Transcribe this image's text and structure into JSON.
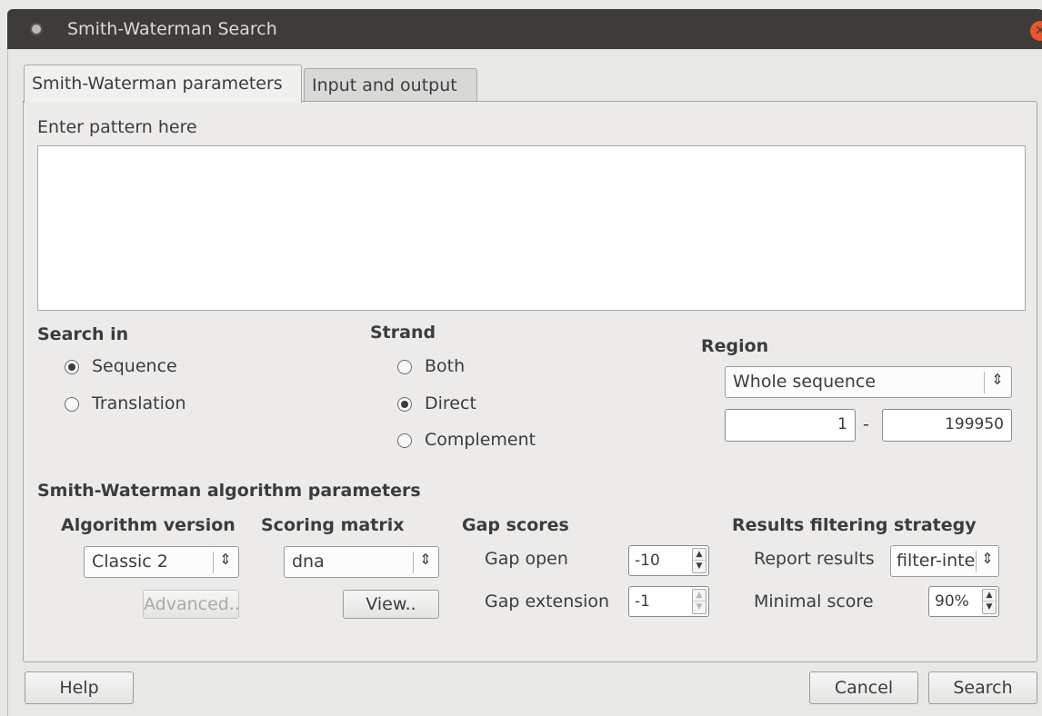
{
  "window": {
    "title": "Smith-Waterman Search"
  },
  "tabs": [
    {
      "label": "Smith-Waterman parameters"
    },
    {
      "label": "Input and output"
    }
  ],
  "pattern": {
    "label": "Enter pattern here",
    "value": ""
  },
  "search_in": {
    "heading": "Search in",
    "options": [
      {
        "label": "Sequence",
        "checked": true
      },
      {
        "label": "Translation",
        "checked": false
      }
    ]
  },
  "strand": {
    "heading": "Strand",
    "options": [
      {
        "label": "Both",
        "checked": false
      },
      {
        "label": "Direct",
        "checked": true
      },
      {
        "label": "Complement",
        "checked": false
      }
    ]
  },
  "region": {
    "heading": "Region",
    "selected": "Whole sequence",
    "start": "1",
    "separator": "-",
    "end": "199950"
  },
  "algo_params": {
    "heading": "Smith-Waterman algorithm parameters",
    "algorithm_version": {
      "heading": "Algorithm version",
      "selected": "Classic 2",
      "advanced_label": "Advanced.."
    },
    "scoring_matrix": {
      "heading": "Scoring matrix",
      "selected": "dna",
      "view_label": "View.."
    },
    "gap_scores": {
      "heading": "Gap scores",
      "gap_open_label": "Gap open",
      "gap_open_value": "-10",
      "gap_extension_label": "Gap  extension",
      "gap_extension_value": "-1"
    },
    "results_filtering": {
      "heading": "Results filtering strategy",
      "report_label": "Report results",
      "report_selected": "filter-intersections",
      "report_display": "filter-inte",
      "min_score_label": "Minimal score",
      "min_score_value": "90%"
    }
  },
  "footer": {
    "help_label": "Help",
    "cancel_label": "Cancel",
    "search_label": "Search"
  },
  "icons": {
    "combo_arrow": "up-down-chevron-icon",
    "spin_up": "chevron-up-icon",
    "spin_down": "chevron-down-icon"
  }
}
